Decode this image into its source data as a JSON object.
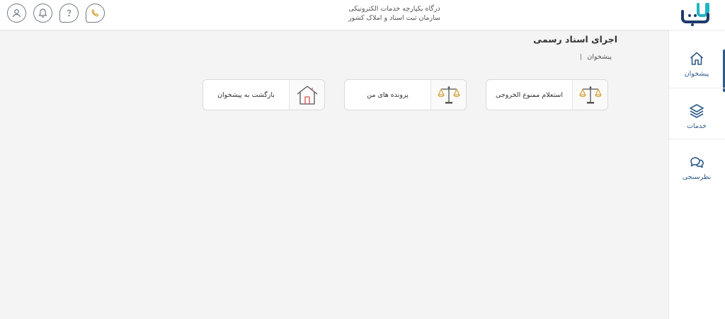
{
  "header": {
    "title_line1": "درگاه یکپارچه خدمات الکترونیکی",
    "title_line2": "سازمان ثبت اسناد و املاک کشور",
    "icons": [
      "user-icon",
      "bell-icon",
      "help-icon",
      "phone-icon"
    ],
    "logo_text": "ثبت من"
  },
  "sidebar": {
    "items": [
      {
        "label": "پیشخوان",
        "icon": "home-icon",
        "active": true
      },
      {
        "label": "خدمات",
        "icon": "layers-icon",
        "active": false
      },
      {
        "label": "نظرسنجی",
        "icon": "chat-icon",
        "active": false
      }
    ]
  },
  "main": {
    "title": "اجرای اسناد رسمی",
    "breadcrumb": "پیشخوان",
    "cards": [
      {
        "label": "استعلام ممنوع الخروجی",
        "icon": "scales-icon"
      },
      {
        "label": "پرونده های من",
        "icon": "scales-icon"
      },
      {
        "label": "بازگشت به پیشخوان",
        "icon": "house-icon"
      }
    ]
  },
  "colors": {
    "accent": "#2d5a8a",
    "gold": "#d9a441",
    "logo_teal": "#1fb5c4",
    "logo_navy": "#1e3a6b"
  }
}
